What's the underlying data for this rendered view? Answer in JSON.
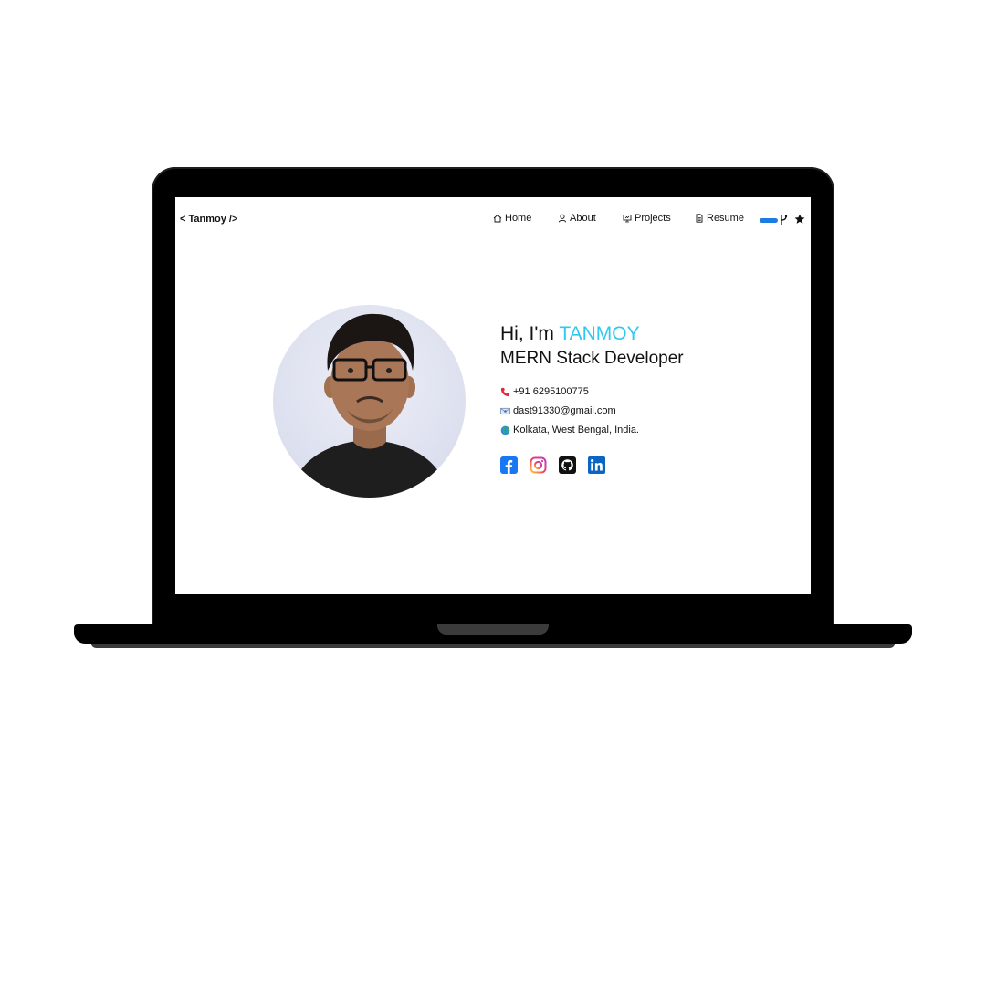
{
  "brand": "< Tanmoy />",
  "nav": {
    "home": "Home",
    "about": "About",
    "projects": "Projects",
    "resume": "Resume"
  },
  "hero": {
    "greeting": "Hi, I'm",
    "name": "TANMOY",
    "role": "MERN Stack Developer"
  },
  "contacts": {
    "phone": "+91 6295100775",
    "email": "dast91330@gmail.com",
    "location": "Kolkata, West Bengal, India."
  },
  "socials": [
    "facebook",
    "instagram",
    "github",
    "linkedin"
  ],
  "colors": {
    "accent_name": "#2fc8f0",
    "toggle": "#1e7be0",
    "facebook": "#1877f2",
    "linkedin": "#0a66c2"
  }
}
